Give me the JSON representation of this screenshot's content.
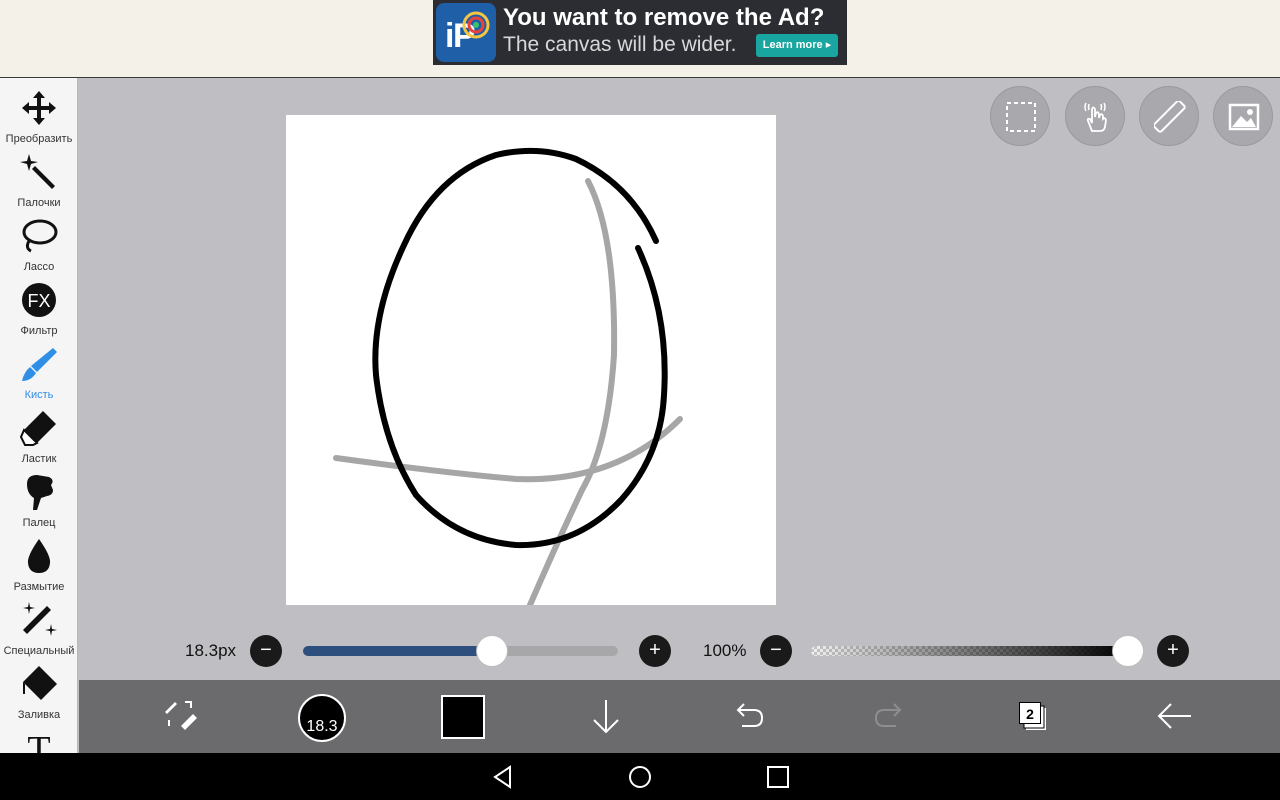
{
  "ad": {
    "title": "You want to remove the Ad?",
    "subtitle": "The canvas will be wider.",
    "cta": "Learn more"
  },
  "tools": [
    {
      "label": "Преобразить",
      "icon": "move-icon"
    },
    {
      "label": "Палочки",
      "icon": "magic-wand-icon"
    },
    {
      "label": "Лассо",
      "icon": "lasso-icon"
    },
    {
      "label": "Фильтр",
      "icon": "fx-icon",
      "glyph": "FX"
    },
    {
      "label": "Кисть",
      "icon": "brush-icon",
      "active": true
    },
    {
      "label": "Ластик",
      "icon": "eraser-icon"
    },
    {
      "label": "Палец",
      "icon": "smudge-icon"
    },
    {
      "label": "Размытие",
      "icon": "blur-icon"
    },
    {
      "label": "Специальный",
      "icon": "special-icon"
    },
    {
      "label": "Заливка",
      "icon": "fill-icon"
    },
    {
      "label": "",
      "icon": "text-icon",
      "glyph": "T"
    }
  ],
  "brush": {
    "size_label": "18.3px",
    "size_fraction": 0.6,
    "size_badge": "18.3"
  },
  "opacity": {
    "label": "100%",
    "fraction": 1.0
  },
  "colors": {
    "accent": "#2f8fe6",
    "slider_fill": "#2c4f7e",
    "current_color": "#000000"
  },
  "layers": {
    "count": "2"
  }
}
